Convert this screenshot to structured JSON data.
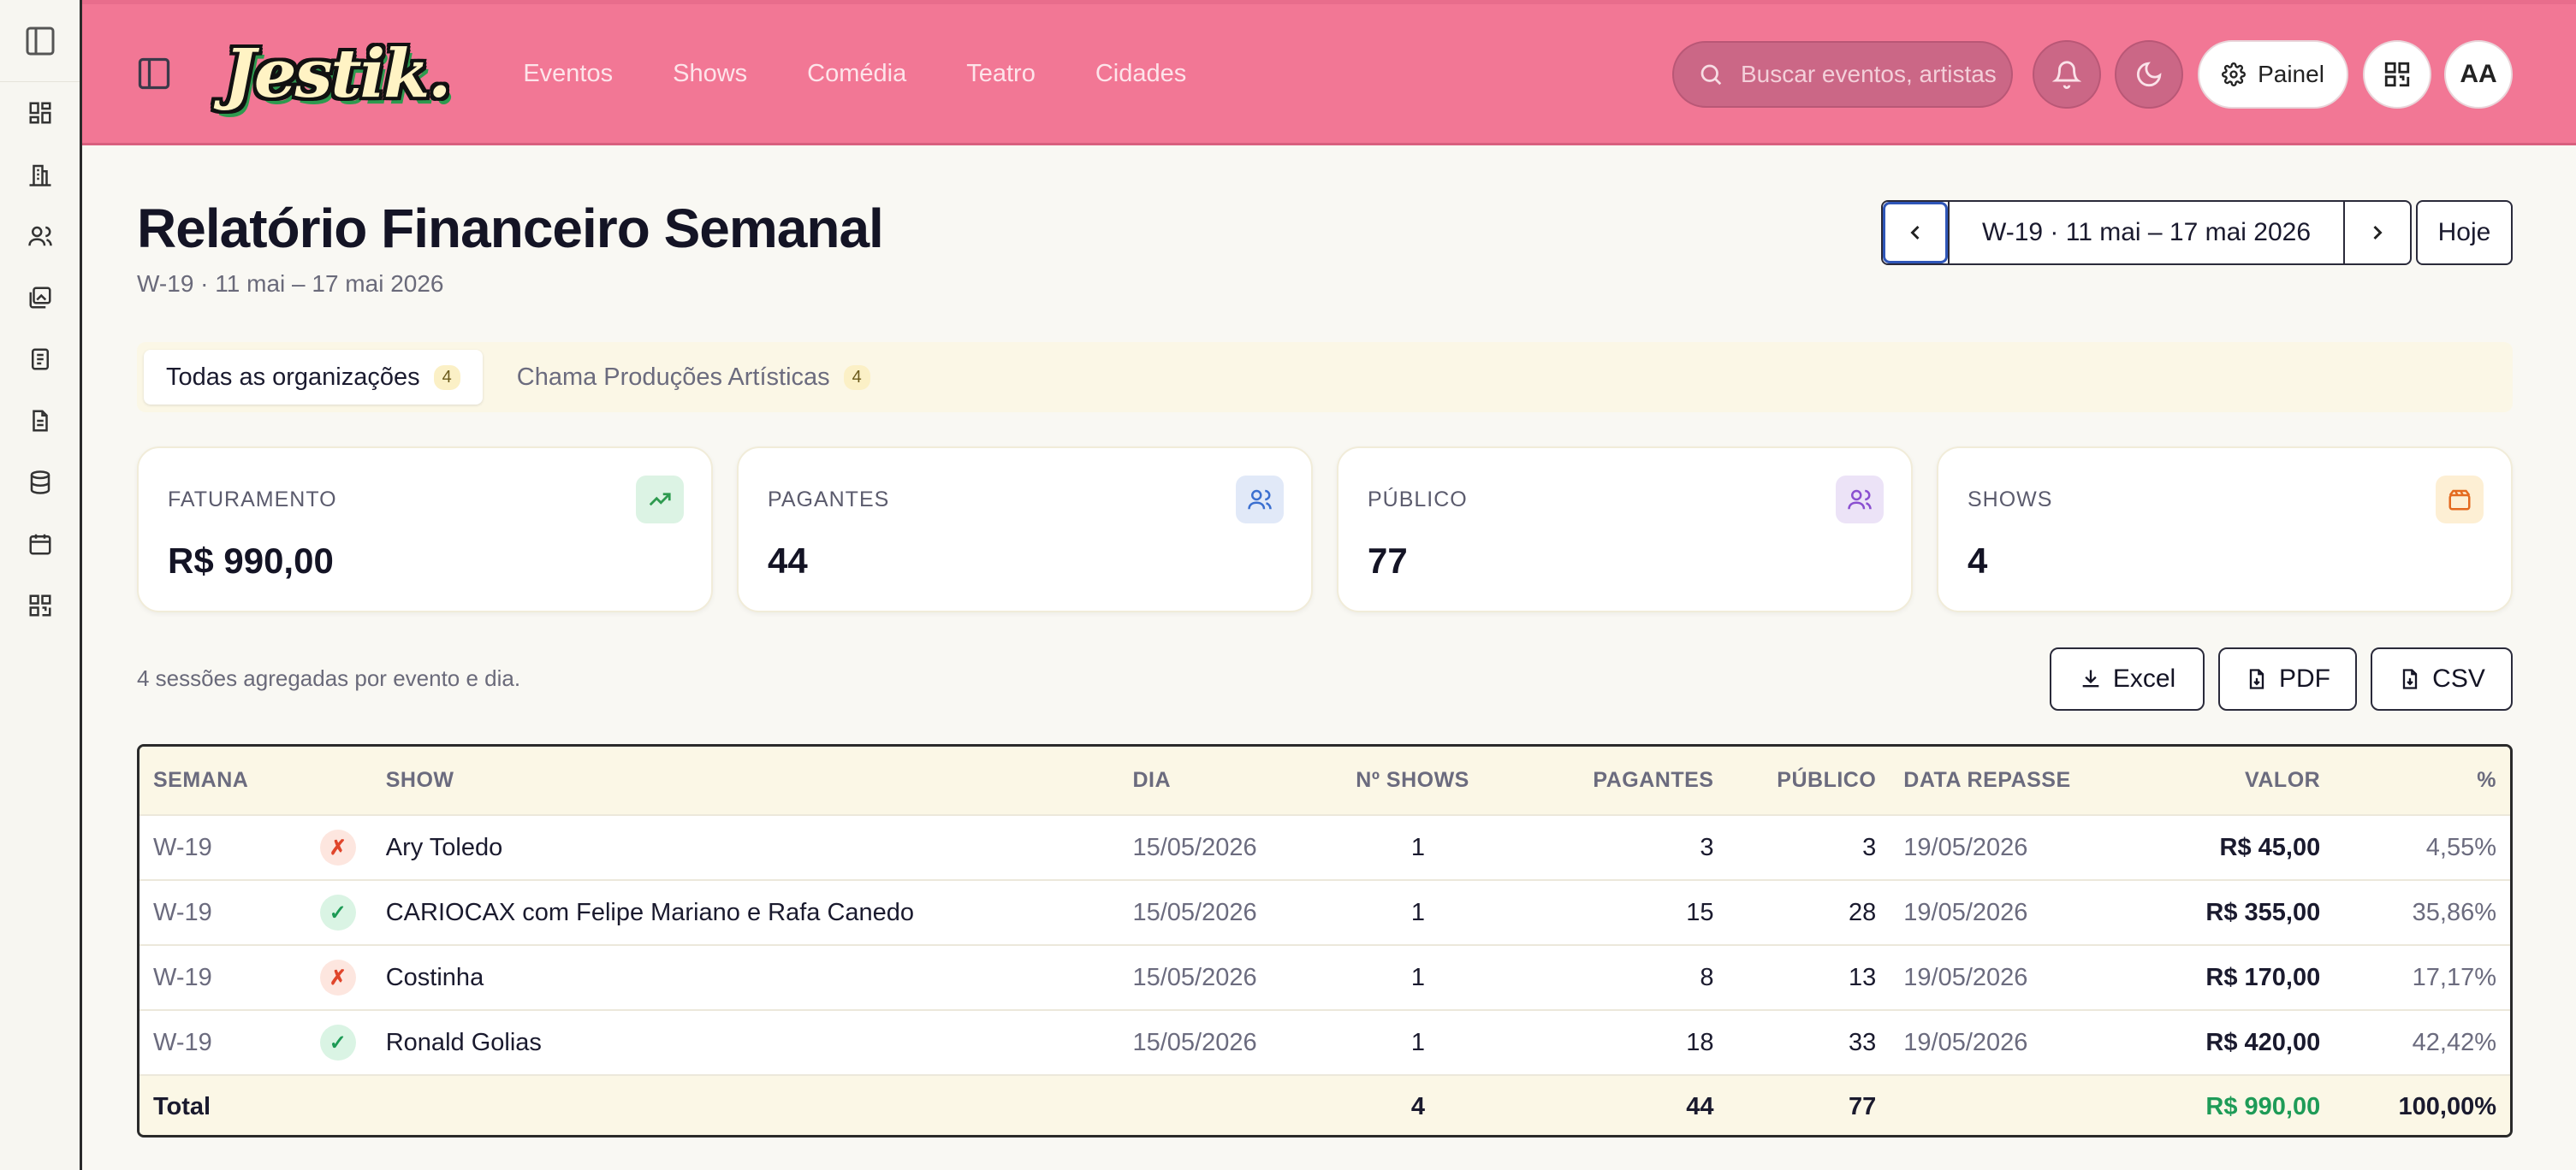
{
  "header": {
    "logo": "Jestik.",
    "nav": [
      "Eventos",
      "Shows",
      "Comédia",
      "Teatro",
      "Cidades"
    ],
    "search_placeholder": "Buscar eventos, artistas, ...",
    "painel_label": "Painel",
    "avatar": "AA"
  },
  "rail": {
    "icons": [
      "sidebar-toggle-icon",
      "dashboard-icon",
      "building-icon",
      "users-icon",
      "images-icon",
      "clipboard-icon",
      "document-icon",
      "database-icon",
      "calendar-icon",
      "qr-code-icon"
    ]
  },
  "page": {
    "title": "Relatório Financeiro Semanal",
    "subtitle": "W-19 · 11 mai – 17 mai 2026",
    "week_label": "W-19 · 11 mai – 17 mai 2026",
    "today_label": "Hoje"
  },
  "org_tabs": [
    {
      "label": "Todas as organizações",
      "count": "4",
      "active": true
    },
    {
      "label": "Chama Produções Artísticas",
      "count": "4",
      "active": false
    }
  ],
  "kpis": [
    {
      "label": "FATURAMENTO",
      "value": "R$ 990,00",
      "icon": "trending-up-icon",
      "color": "#2e9a4f",
      "bg": "#dcf3e4"
    },
    {
      "label": "PAGANTES",
      "value": "44",
      "icon": "users-icon",
      "color": "#3b6fd0",
      "bg": "#e1e9f8"
    },
    {
      "label": "PÚBLICO",
      "value": "77",
      "icon": "users-icon",
      "color": "#8a4fd0",
      "bg": "#ece3f7"
    },
    {
      "label": "SHOWS",
      "value": "4",
      "icon": "clapperboard-icon",
      "color": "#e46a1f",
      "bg": "#fdefd4"
    }
  ],
  "aggregation_note": "4 sessões agregadas por evento e dia.",
  "exports": {
    "excel": "Excel",
    "pdf": "PDF",
    "csv": "CSV"
  },
  "table": {
    "columns": [
      "SEMANA",
      "",
      "SHOW",
      "DIA",
      "Nº SHOWS",
      "PAGANTES",
      "PÚBLICO",
      "DATA REPASSE",
      "VALOR",
      "%"
    ],
    "rows": [
      {
        "semana": "W-19",
        "status": "✗",
        "ok": false,
        "show": "Ary Toledo",
        "dia": "15/05/2026",
        "shows": "1",
        "pagantes": "3",
        "publico": "3",
        "repasse": "19/05/2026",
        "valor": "R$ 45,00",
        "pct": "4,55%"
      },
      {
        "semana": "W-19",
        "status": "✓",
        "ok": true,
        "show": "CARIOCAX com Felipe Mariano e Rafa Canedo",
        "dia": "15/05/2026",
        "shows": "1",
        "pagantes": "15",
        "publico": "28",
        "repasse": "19/05/2026",
        "valor": "R$ 355,00",
        "pct": "35,86%"
      },
      {
        "semana": "W-19",
        "status": "✗",
        "ok": false,
        "show": "Costinha",
        "dia": "15/05/2026",
        "shows": "1",
        "pagantes": "8",
        "publico": "13",
        "repasse": "19/05/2026",
        "valor": "R$ 170,00",
        "pct": "17,17%"
      },
      {
        "semana": "W-19",
        "status": "✓",
        "ok": true,
        "show": "Ronald Golias",
        "dia": "15/05/2026",
        "shows": "1",
        "pagantes": "18",
        "publico": "33",
        "repasse": "19/05/2026",
        "valor": "R$ 420,00",
        "pct": "42,42%"
      }
    ],
    "total": {
      "label": "Total",
      "shows": "4",
      "pagantes": "44",
      "publico": "77",
      "valor": "R$ 990,00",
      "pct": "100,00%"
    }
  }
}
